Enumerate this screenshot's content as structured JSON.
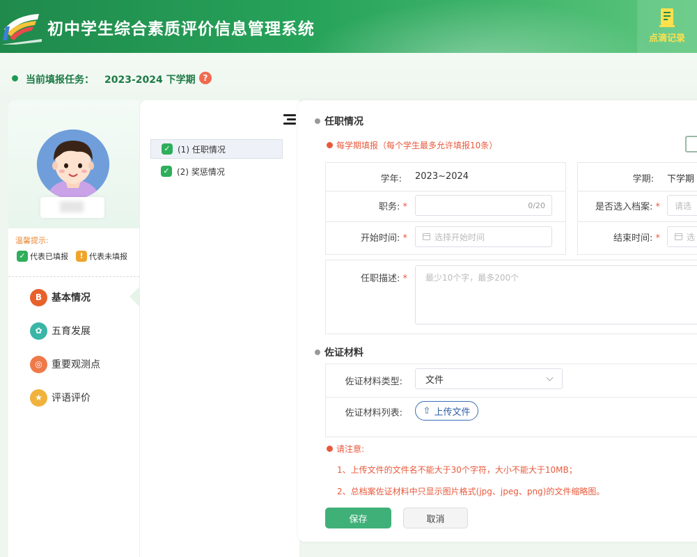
{
  "header": {
    "title": "初中学生综合素质评价信息管理系统",
    "record_label": "点滴记录",
    "accent_color": "#27a35a"
  },
  "task": {
    "label": "当前填报任务：",
    "value": "2023-2024 下学期",
    "help_icon": "question-icon"
  },
  "sidebar": {
    "hint_title": "温馨提示:",
    "legend_filled": "代表已填报",
    "legend_unfilled": "代表未填报",
    "items": [
      {
        "label": "基本情况",
        "icon": "person-badge-icon",
        "color": "#e8612b",
        "active": true
      },
      {
        "label": "五育发展",
        "icon": "flower-icon",
        "color": "#3ab5a6",
        "active": false
      },
      {
        "label": "重要观测点",
        "icon": "target-icon",
        "color": "#ee7a4a",
        "active": false
      },
      {
        "label": "评语评价",
        "icon": "shield-icon",
        "color": "#f0b23c",
        "active": false
      }
    ]
  },
  "subnav": {
    "items": [
      {
        "label": "(1) 任职情况",
        "active": true
      },
      {
        "label": "(2) 奖惩情况",
        "active": false
      }
    ]
  },
  "position": {
    "section_title": "任职情况",
    "warn": "每学期填报（每个学生最多允许填报10条）",
    "year_label": "学年:",
    "year_value": "2023~2024",
    "term_label": "学期:",
    "term_value": "下学期",
    "duty_label": "职务:",
    "duty_count": "0/20",
    "archive_label": "是否选入档案:",
    "archive_placeholder": "请选",
    "start_label": "开始时间:",
    "start_placeholder": "选择开始时间",
    "end_label": "结束时间:",
    "end_placeholder": "选",
    "desc_label": "任职描述:",
    "desc_placeholder": "最少10个字，最多200个"
  },
  "evidence": {
    "section_title": "佐证材料",
    "type_label": "佐证材料类型:",
    "type_value": "文件",
    "list_label": "佐证材料列表:",
    "upload_label": "上传文件"
  },
  "notice": {
    "title": "请注意:",
    "line1": "1、上传文件的文件名不能大于30个字符，大小不能大于10MB；",
    "line2": "2、总档案佐证材料中只显示图片格式(jpg、jpeg、png)的文件缩略图。"
  },
  "actions": {
    "save": "保存",
    "cancel": "取消",
    "save_color": "#40b079"
  }
}
